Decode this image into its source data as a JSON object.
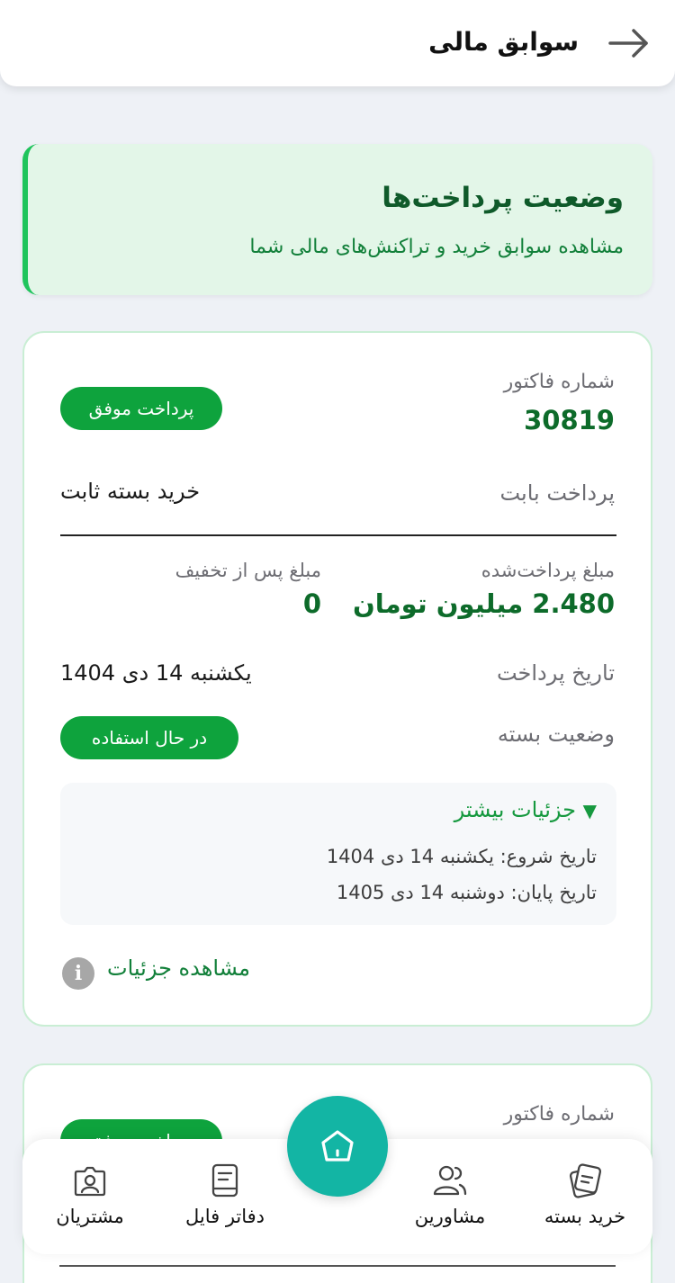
{
  "header": {
    "title": "سوابق مالی",
    "back_icon": "arrow-right-icon"
  },
  "intro": {
    "title": "وضعیت پرداخت‌ها",
    "subtitle": "مشاهده سوابق خرید و تراکنش‌های مالی شما",
    "accent_color": "#1fc45c"
  },
  "invoices": [
    {
      "invoice_label": "شماره فاکتور",
      "invoice_number": "30819",
      "status_badge": "پرداخت موفق",
      "payment_for_label": "پرداخت بابت",
      "payment_for_value": "خرید بسته ثابت",
      "paid_amount_label": "مبلغ پرداخت‌شده",
      "paid_amount_value": "2.480 میلیون تومان",
      "discount_label": "مبلغ پس از تخفیف",
      "discount_value": "0",
      "payment_date_label": "تاریخ پرداخت",
      "payment_date_value": "یکشنبه 14 دی 1404",
      "package_status_label": "وضعیت بسته",
      "package_status_value": "در حال استفاده",
      "details_toggle": "جزئیات بیشتر",
      "start_date": "تاریخ شروع: یکشنبه 14 دی 1404",
      "end_date": "تاریخ پایان: دوشنبه 14 دی 1405",
      "view_details": "مشاهده جزئیات"
    },
    {
      "invoice_label": "شماره فاکتور",
      "status_badge": "پرداخت موفق"
    }
  ],
  "nav": {
    "items": [
      {
        "label": "خرید بسته",
        "icon": "package-card-icon"
      },
      {
        "label": "مشاورین",
        "icon": "advisors-icon"
      },
      {
        "label": "دفاتر فایل",
        "icon": "file-book-icon"
      },
      {
        "label": "مشتریان",
        "icon": "customer-profile-icon"
      }
    ],
    "home_icon": "home-icon"
  },
  "colors": {
    "brand_green": "#0ea33d",
    "dark_green": "#0d6b2a",
    "teal": "#13b5a4",
    "background": "#eef1f6"
  }
}
